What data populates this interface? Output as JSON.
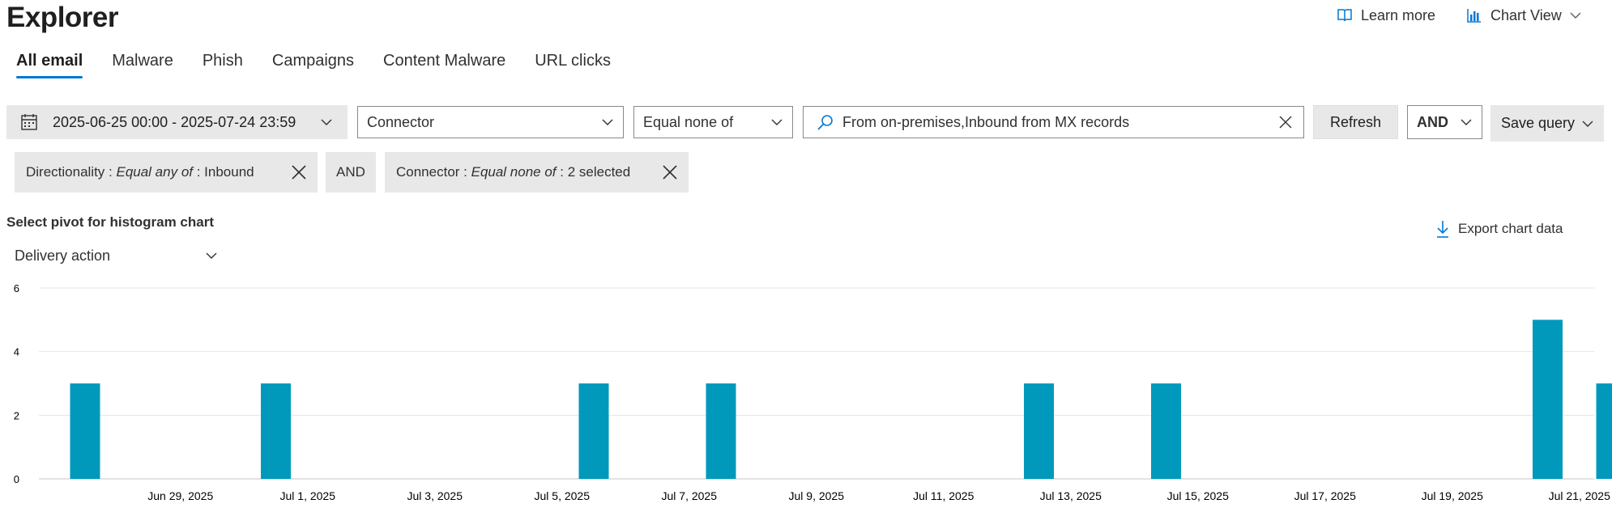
{
  "header": {
    "title": "Explorer",
    "learn_more_label": "Learn more",
    "view_label": "Chart View"
  },
  "tabs": [
    {
      "label": "All email",
      "active": true
    },
    {
      "label": "Malware",
      "active": false
    },
    {
      "label": "Phish",
      "active": false
    },
    {
      "label": "Campaigns",
      "active": false
    },
    {
      "label": "Content Malware",
      "active": false
    },
    {
      "label": "URL clicks",
      "active": false
    }
  ],
  "query": {
    "date_range": "2025-06-25 00:00 - 2025-07-24 23:59",
    "field": "Connector",
    "operator": "Equal none of",
    "value": "From on-premises,Inbound from MX records",
    "refresh_label": "Refresh",
    "logic": "AND",
    "save_label": "Save query"
  },
  "filters": {
    "chip1": {
      "field": "Directionality",
      "op": "Equal any of",
      "value": "Inbound"
    },
    "joiner": "AND",
    "chip2": {
      "field": "Connector",
      "op": "Equal none of",
      "value": "2 selected"
    }
  },
  "pivot": {
    "label": "Select pivot for histogram chart",
    "selected": "Delivery action",
    "export_label": "Export chart data"
  },
  "colors": {
    "accent": "#0078d4",
    "bar": "#0099bc",
    "chip_bg": "#e8e8e8"
  },
  "chart_data": {
    "type": "bar",
    "categories": [
      "Jun 28, 2025",
      "Jul 1, 2025",
      "Jul 6, 2025",
      "Jul 8, 2025",
      "Jul 13, 2025",
      "Jul 15, 2025",
      "Jul 21, 2025",
      "Jul 22, 2025"
    ],
    "values": [
      3,
      3,
      3,
      3,
      3,
      3,
      5,
      3
    ],
    "series": [
      {
        "values": [
          3,
          3,
          3,
          3,
          3,
          3,
          5,
          3
        ]
      }
    ],
    "x_range": [
      "Jun 27, 2025",
      "Jul 22, 2025"
    ],
    "x_ticks": [
      "Jun 29, 2025",
      "Jul 1, 2025",
      "Jul 3, 2025",
      "Jul 5, 2025",
      "Jul 7, 2025",
      "Jul 9, 2025",
      "Jul 11, 2025",
      "Jul 13, 2025",
      "Jul 15, 2025",
      "Jul 17, 2025",
      "Jul 19, 2025",
      "Jul 21, 2025"
    ],
    "y_ticks": [
      0,
      2,
      4,
      6
    ],
    "ylim": [
      0,
      6
    ],
    "grid": true,
    "legend": "none"
  }
}
